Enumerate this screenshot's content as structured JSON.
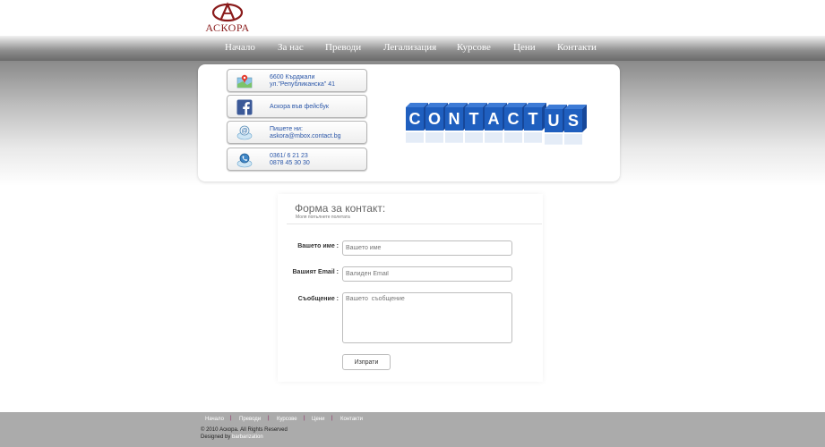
{
  "logo": {
    "text": "АСКОРА"
  },
  "nav": {
    "items": [
      {
        "label": "Начало"
      },
      {
        "label": "За нас"
      },
      {
        "label": "Преводи"
      },
      {
        "label": "Легализация"
      },
      {
        "label": "Курсове"
      },
      {
        "label": "Цени"
      },
      {
        "label": "Контакти"
      }
    ]
  },
  "contact_cards": [
    {
      "icon": "map-icon",
      "line1": "6600 Кърджали",
      "line2": "ул.\"Републиканска\" 41"
    },
    {
      "icon": "facebook-icon",
      "line1": "Аскора във фейсбук"
    },
    {
      "icon": "email-icon",
      "line1": "Пишете ни:",
      "line2": "askora@mbox.contact.bg"
    },
    {
      "icon": "phone-icon",
      "line1": "0361/ 6 21 23",
      "line2": "0878 45 30 30"
    }
  ],
  "banner": {
    "cubes_top": "CONTACT",
    "cubes_right": "US"
  },
  "form": {
    "title": "Форма за контакт:",
    "subtitle": "Моля попълнете полетата",
    "name_label": "Вашето име :",
    "name_placeholder": "Вашето име",
    "email_label": "Вашият Email :",
    "email_placeholder": "Валиден Email",
    "message_label": "Съобщение :",
    "message_placeholder": "Вашето  съобщение",
    "submit_label": "Изпрати"
  },
  "footer": {
    "links": [
      {
        "label": "Начало"
      },
      {
        "label": "Преводи"
      },
      {
        "label": "Курсове"
      },
      {
        "label": "Цени"
      },
      {
        "label": "Контакти"
      }
    ],
    "separator": "|",
    "copyright": "© 2010 Аскора. All Rights Reserved",
    "designed_by": "Designed by",
    "designer": "barbarization"
  },
  "colors": {
    "brand": "#8a1b1b",
    "link": "#2a56a8",
    "cube": "#1f5fbf",
    "footer": "#ababab"
  }
}
